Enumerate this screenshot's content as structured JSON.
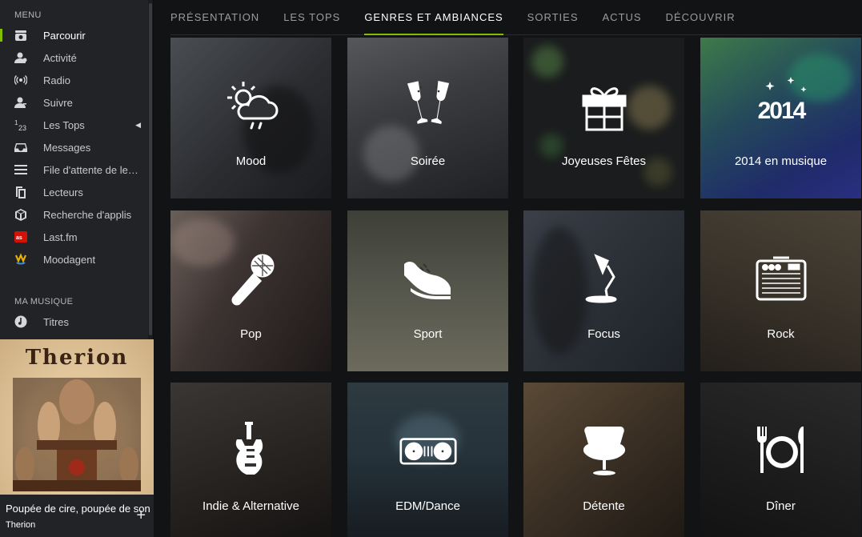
{
  "sidebar": {
    "menu_heading": "MENU",
    "items": [
      {
        "label": "Parcourir",
        "icon": "browse-icon",
        "active": true
      },
      {
        "label": "Activité",
        "icon": "activity-icon"
      },
      {
        "label": "Radio",
        "icon": "radio-icon"
      },
      {
        "label": "Suivre",
        "icon": "follow-icon"
      },
      {
        "label": "Les Tops",
        "icon": "top-lists-icon"
      },
      {
        "label": "Messages",
        "icon": "inbox-icon"
      },
      {
        "label": "File d'attente de lecture",
        "icon": "queue-icon"
      },
      {
        "label": "Lecteurs",
        "icon": "devices-icon"
      },
      {
        "label": "Recherche d'applis",
        "icon": "app-finder-icon"
      },
      {
        "label": "Last.fm",
        "icon": "lastfm-icon"
      },
      {
        "label": "Moodagent",
        "icon": "moodagent-icon"
      }
    ],
    "music_heading": "MA MUSIQUE",
    "music_items": [
      {
        "label": "Titres",
        "icon": "tracks-icon"
      }
    ]
  },
  "now_playing": {
    "cover_text": "Therion",
    "track": "Poupée de cire, poupée de son",
    "artist": "Therion"
  },
  "tabs": [
    {
      "label": "PRÉSENTATION"
    },
    {
      "label": "LES TOPS"
    },
    {
      "label": "GENRES ET AMBIANCES",
      "active": true
    },
    {
      "label": "SORTIES"
    },
    {
      "label": "ACTUS"
    },
    {
      "label": "DÉCOUVRIR"
    }
  ],
  "genres": [
    {
      "label": "Mood",
      "icon": "weather-icon"
    },
    {
      "label": "Soirée",
      "icon": "champagne-icon"
    },
    {
      "label": "Joyeuses Fêtes",
      "icon": "gift-icon"
    },
    {
      "label": "2014 en musique",
      "icon": "year-2014-icon",
      "icon_text": "2014"
    },
    {
      "label": "Pop",
      "icon": "microphone-icon"
    },
    {
      "label": "Sport",
      "icon": "sneaker-icon"
    },
    {
      "label": "Focus",
      "icon": "desk-lamp-icon"
    },
    {
      "label": "Rock",
      "icon": "amplifier-icon"
    },
    {
      "label": "Indie & Alternative",
      "icon": "electric-guitar-icon"
    },
    {
      "label": "EDM/Dance",
      "icon": "turntable-icon"
    },
    {
      "label": "Détente",
      "icon": "lounge-chair-icon"
    },
    {
      "label": "Dîner",
      "icon": "plate-cutlery-icon"
    }
  ],
  "colors": {
    "accent": "#84bd00",
    "sidebar_bg": "#222326",
    "main_bg": "#121314"
  }
}
